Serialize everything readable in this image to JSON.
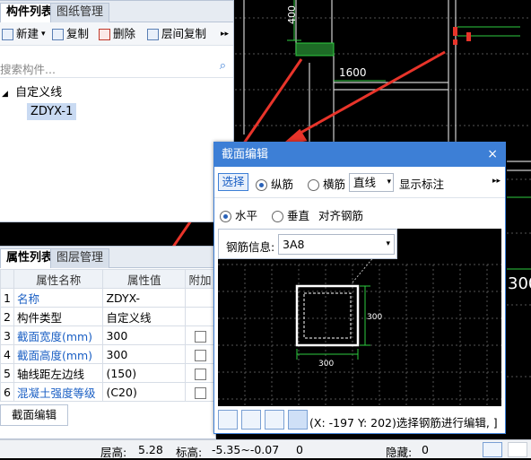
{
  "top_panel": {
    "tabs": [
      "构件列表",
      "图纸管理"
    ],
    "toolbar": {
      "new": "新建",
      "copy": "复制",
      "delete": "删除",
      "floor_copy": "层间复制",
      "more": "▸▸"
    },
    "search_placeholder": "搜索构件...",
    "tree": {
      "root": "自定义线",
      "child": "ZDYX-1"
    }
  },
  "props_panel": {
    "tabs": [
      "属性列表",
      "图层管理"
    ],
    "columns": [
      "属性名称",
      "属性值",
      "附加"
    ],
    "rows": [
      {
        "no": "1",
        "name": "名称",
        "value": "ZDYX-",
        "blue": true,
        "check": false
      },
      {
        "no": "2",
        "name": "构件类型",
        "value": "自定义线",
        "blue": false,
        "check": false
      },
      {
        "no": "3",
        "name": "截面宽度(mm)",
        "value": "300",
        "blue": true,
        "check": true
      },
      {
        "no": "4",
        "name": "截面高度(mm)",
        "value": "300",
        "blue": true,
        "check": true
      },
      {
        "no": "5",
        "name": "轴线距左边线",
        "value": "(150)",
        "blue": false,
        "check": true
      },
      {
        "no": "6",
        "name": "混凝土强度等级",
        "value": "(C20)",
        "blue": true,
        "check": true
      }
    ],
    "section_edit_button": "截面编辑"
  },
  "dialog": {
    "title": "截面编辑",
    "close": "×",
    "select": "选择",
    "longitudinal": "纵筋",
    "stirrup": "横筋",
    "line_mode": "直线",
    "show_label": "显示标注",
    "more": "▸▸",
    "horizontal": "水平",
    "vertical": "垂直",
    "align_rebar": "对齐钢筋",
    "rebar_info_label": "钢筋信息:",
    "rebar_info_value": "3A8",
    "dim_width": "300",
    "dim_height": "300",
    "hint": "(X: -197 Y: 202)选择钢筋进行编辑, ]"
  },
  "cad": {
    "dim_400": "400",
    "dim_1600": "1600",
    "right_text": "300"
  },
  "status": {
    "floor_height_label": "层高:",
    "floor_height": "5.28",
    "elev_label": "标高:",
    "elev": "-5.35~-0.07",
    "count": "0",
    "hidden_label": "隐藏:",
    "hidden": "0"
  },
  "colors": {
    "accent": "#3d7fd6",
    "cad_green": "#2ecc40",
    "arrow_red": "#e8342a"
  }
}
